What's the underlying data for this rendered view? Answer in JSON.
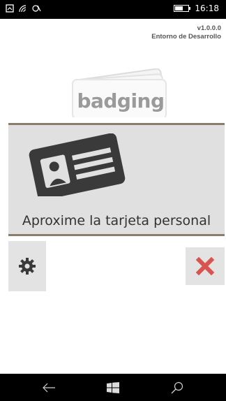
{
  "status_bar": {
    "time": "16:18",
    "battery_level": 0.6,
    "icons": [
      "notification-icon",
      "wifi-icon",
      "nfc-icon",
      "battery-icon"
    ]
  },
  "header": {
    "version": "v1.0.0.0",
    "environment": "Entorno de Desarrollo"
  },
  "logo": {
    "text": "badging"
  },
  "card_panel": {
    "icon": "id-card-icon",
    "prompt": "Aproxime la tarjeta personal"
  },
  "actions": {
    "settings_icon": "gear-icon",
    "close_icon": "close-icon"
  },
  "nav_bar": {
    "icons": [
      "back-arrow-icon",
      "windows-icon",
      "search-icon"
    ]
  },
  "colors": {
    "panel_bg": "#e0e0e0",
    "panel_border": "#8a7d6d",
    "close_red": "#d9534f",
    "icon_dark": "#3a3a3a"
  }
}
